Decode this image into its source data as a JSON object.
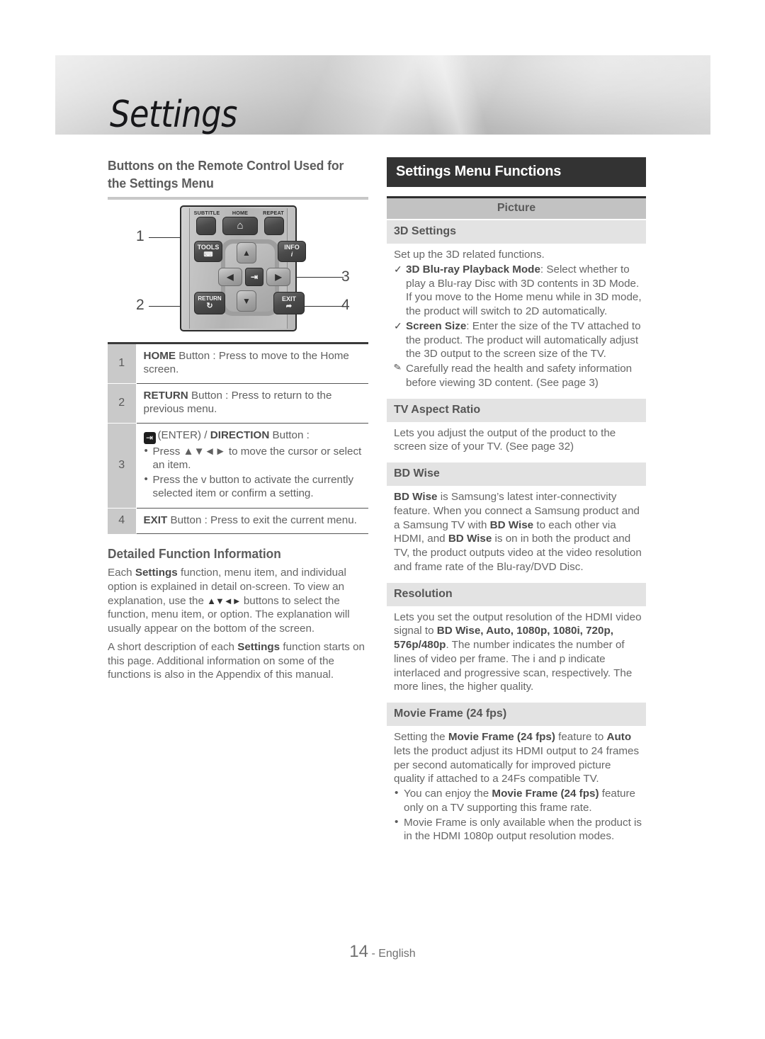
{
  "page_title": "Settings",
  "left": {
    "heading": "Buttons on the Remote Control Used for the Settings Menu",
    "remote": {
      "labels": {
        "subtitle": "SUBTITLE",
        "home": "HOME",
        "repeat": "REPEAT"
      },
      "buttons": {
        "tools": "TOOLS",
        "info": "INFO",
        "info_sub": "i",
        "return": "RETURN",
        "exit": "EXIT",
        "home_icon": "home-icon",
        "enter_icon": "enter-icon",
        "up_icon": "arrow-up-icon",
        "down_icon": "arrow-down-icon",
        "left_icon": "arrow-left-icon",
        "right_icon": "arrow-right-icon",
        "return_icon": "return-arrow-icon",
        "exit_icon": "exit-icon",
        "tools_icon": "tools-icon"
      },
      "callouts": [
        "1",
        "2",
        "3",
        "4"
      ]
    },
    "table": [
      {
        "num": "1",
        "bold": "HOME",
        "text": " Button : Press to move to the Home screen."
      },
      {
        "num": "2",
        "bold": "RETURN",
        "text": " Button : Press to return to the previous menu."
      },
      {
        "num": "3",
        "title_prefix": "(ENTER) / ",
        "title_bold": "DIRECTION",
        "title_suffix": " Button :",
        "bullets": [
          "Press ▲▼◄► to move the cursor or select an item.",
          "Press the ᴠ button to activate the currently selected item or confirm a setting."
        ]
      },
      {
        "num": "4",
        "bold": "EXIT",
        "text": " Button : Press to exit the current menu."
      }
    ],
    "detail": {
      "heading": "Detailed Function Information",
      "p1_a": "Each ",
      "p1_b": "Settings",
      "p1_c": " function, menu item, and individual option is explained in detail on-screen. To view an explanation, use the ",
      "p1_arrows": "▲▼◄►",
      "p1_d": " buttons to select the function, menu item, or option. The explanation will usually appear on the bottom of the screen.",
      "p2_a": "A short description of each ",
      "p2_b": "Settings",
      "p2_c": " function starts on this page. Additional information on some of the functions is also in the Appendix of this manual."
    }
  },
  "right": {
    "banner": "Settings Menu Functions",
    "category": "Picture",
    "items": [
      {
        "name": "3D Settings",
        "intro": "Set up the 3D related functions.",
        "checks": [
          {
            "mark": "✓",
            "bold": "3D Blu-ray Playback Mode",
            "text": ": Select whether to play a Blu-ray Disc with 3D contents in 3D Mode. If you move to the Home menu while in 3D mode, the product will switch to 2D automatically."
          },
          {
            "mark": "✓",
            "bold": "Screen Size",
            "text": ": Enter the size of the TV attached to the product. The product will automatically adjust the 3D output to the screen size of the TV."
          },
          {
            "mark": "✎",
            "note": true,
            "bold": "",
            "text": "Carefully read the health and safety information before viewing 3D content. (See page 3)"
          }
        ]
      },
      {
        "name": "TV Aspect Ratio",
        "intro": "Lets you adjust the output of the product to the screen size of your TV. (See page 32)",
        "checks": []
      },
      {
        "name": "BD Wise",
        "intro_rich": [
          {
            "t": "BD Wise",
            "b": true
          },
          {
            "t": " is Samsung’s latest inter-connectivity feature. When you connect a Samsung product and a Samsung TV with ",
            "b": false
          },
          {
            "t": "BD Wise",
            "b": true
          },
          {
            "t": " to each other via HDMI, and ",
            "b": false
          },
          {
            "t": "BD Wise",
            "b": true
          },
          {
            "t": " is on in both the product and TV, the product outputs video at the video resolution and frame rate of the Blu-ray/DVD Disc.",
            "b": false
          }
        ],
        "checks": []
      },
      {
        "name": "Resolution",
        "intro_rich": [
          {
            "t": "Lets you set the output resolution of the HDMI video signal to ",
            "b": false
          },
          {
            "t": "BD Wise, Auto, 1080p, 1080i, 720p, 576p/480p",
            "b": true
          },
          {
            "t": ". The number indicates the number of lines of video per frame. The i and p indicate interlaced and progressive scan, respectively. The more lines, the higher quality.",
            "b": false
          }
        ],
        "checks": []
      },
      {
        "name": "Movie Frame (24 fps)",
        "intro_rich": [
          {
            "t": "Setting the ",
            "b": false
          },
          {
            "t": "Movie Frame (24 fps)",
            "b": true
          },
          {
            "t": " feature to ",
            "b": false
          },
          {
            "t": "Auto",
            "b": true
          },
          {
            "t": " lets the product adjust its HDMI output to 24 frames per second automatically for improved picture quality if attached to a 24Fs compatible TV.",
            "b": false
          }
        ],
        "bullets_rich": [
          [
            {
              "t": "You can enjoy the ",
              "b": false
            },
            {
              "t": "Movie Frame (24 fps)",
              "b": true
            },
            {
              "t": " feature only on a TV supporting this frame rate.",
              "b": false
            }
          ],
          [
            {
              "t": "Movie Frame is only available when the product is in the HDMI 1080p output resolution modes.",
              "b": false
            }
          ]
        ],
        "checks": []
      }
    ]
  },
  "footer": {
    "page_number": "14",
    "separator": " - ",
    "language": "English"
  }
}
